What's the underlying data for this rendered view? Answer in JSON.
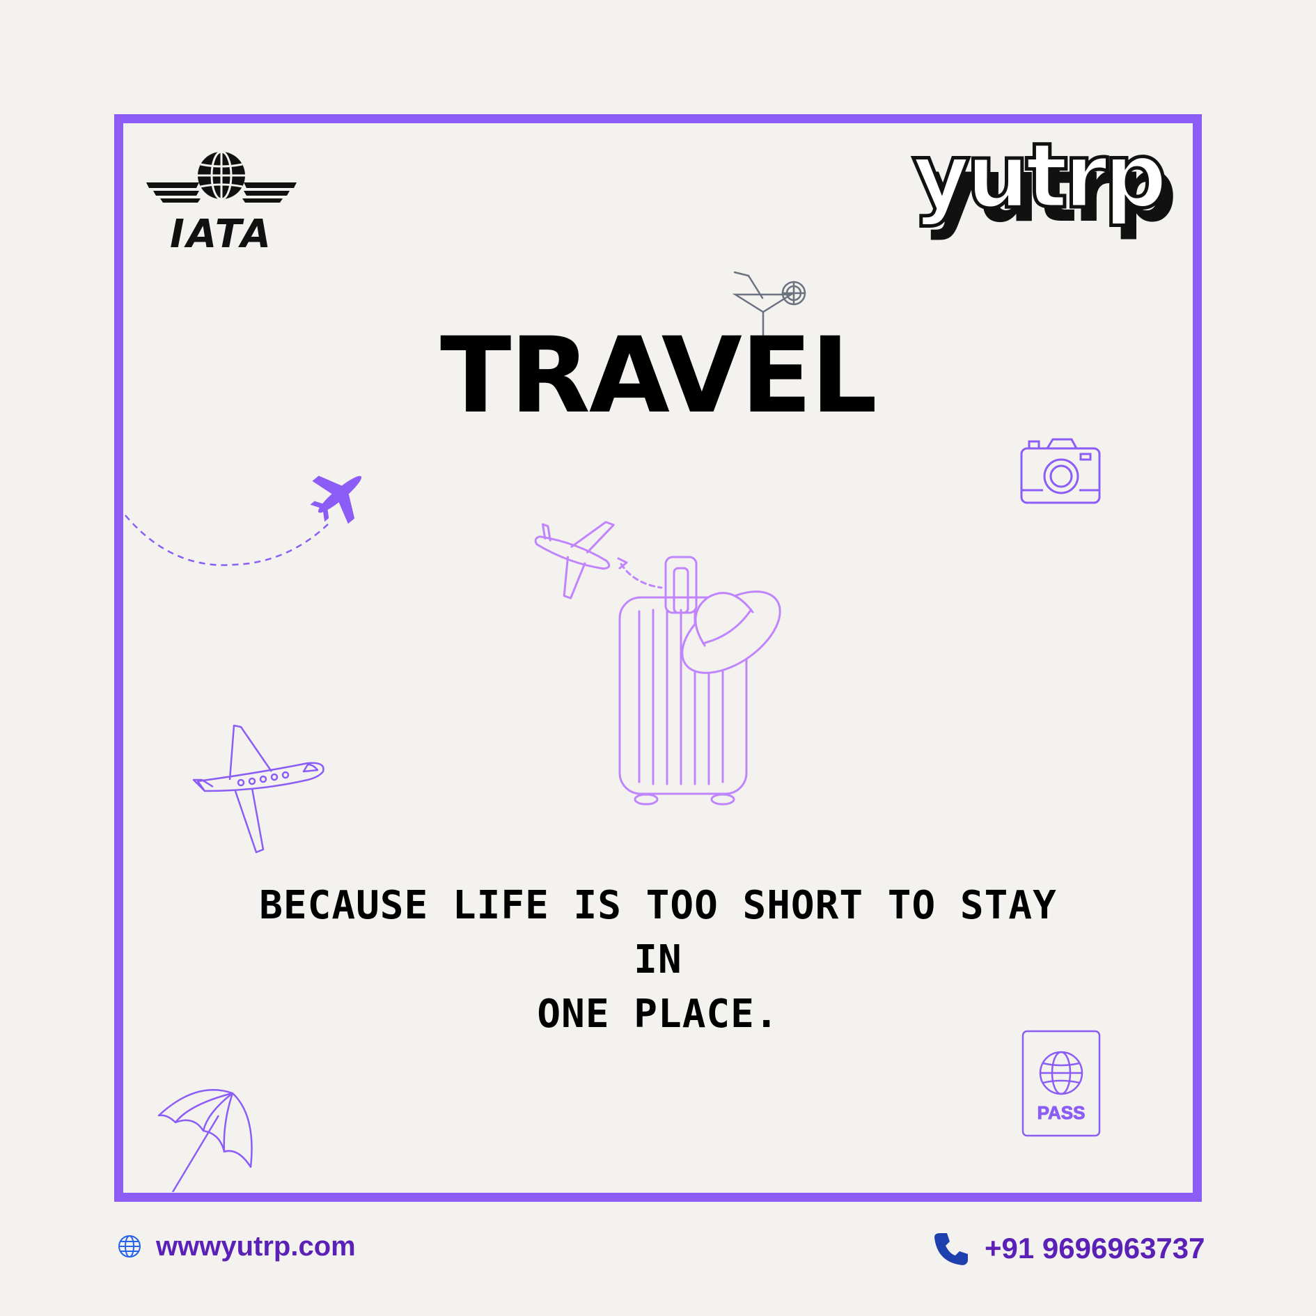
{
  "logos": {
    "iata": "IATA",
    "brand": "yutrp"
  },
  "headline": "TRAVEL",
  "tagline_lines": [
    "BECAUSE LIFE IS TOO SHORT TO STAY IN",
    "ONE PLACE."
  ],
  "passport_label": "PASS",
  "footer": {
    "website": "wwwyutrp.com",
    "phone": "+91 9696963737"
  },
  "colors": {
    "frame": "#8b5cf6",
    "accent_text": "#5b21b6",
    "illustration": "#c084fc",
    "background": "#f3f2ee"
  },
  "icons": [
    "globe-icon",
    "phone-icon",
    "cocktail-icon",
    "camera-icon",
    "airplane-icon",
    "suitcase-icon",
    "hat-icon",
    "beach-umbrella-icon",
    "passport-icon"
  ]
}
